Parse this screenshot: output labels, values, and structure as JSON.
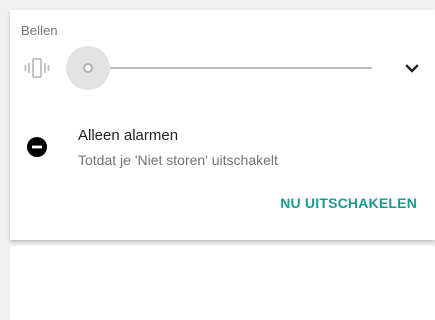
{
  "volume_panel": {
    "stream_label": "Bellen",
    "vibrate_icon": "vibrate-icon",
    "slider_level": 0,
    "expand_icon": "chevron-down-icon"
  },
  "dnd": {
    "icon": "do-not-disturb-icon",
    "title": "Alleen alarmen",
    "subtitle": "Totdat je 'Niet storen' uitschakelt",
    "turn_off_label": "NU UITSCHAKELEN"
  },
  "colors": {
    "accent": "#1a9c92",
    "title_text": "#212121",
    "secondary_text": "#737373",
    "slider_track": "#bdbdbd"
  }
}
